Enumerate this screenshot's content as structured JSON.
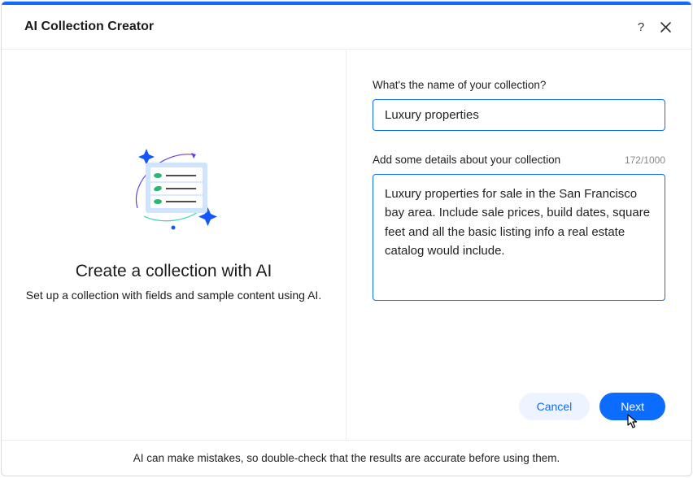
{
  "header": {
    "title": "AI Collection Creator"
  },
  "left": {
    "title": "Create a collection with AI",
    "subtitle": "Set up a collection with fields and sample content using AI."
  },
  "form": {
    "name_label": "What's the name of your collection?",
    "name_value": "Luxury properties",
    "details_label": "Add some details about your collection",
    "details_counter": "172/1000",
    "details_value": "Luxury properties for sale in the San Francisco bay area. Include sale prices, build dates, square feet and all the basic listing info a real estate catalog would include."
  },
  "buttons": {
    "cancel": "Cancel",
    "next": "Next"
  },
  "footer": {
    "disclaimer": "AI can make mistakes, so double-check that the results are accurate before using them."
  }
}
